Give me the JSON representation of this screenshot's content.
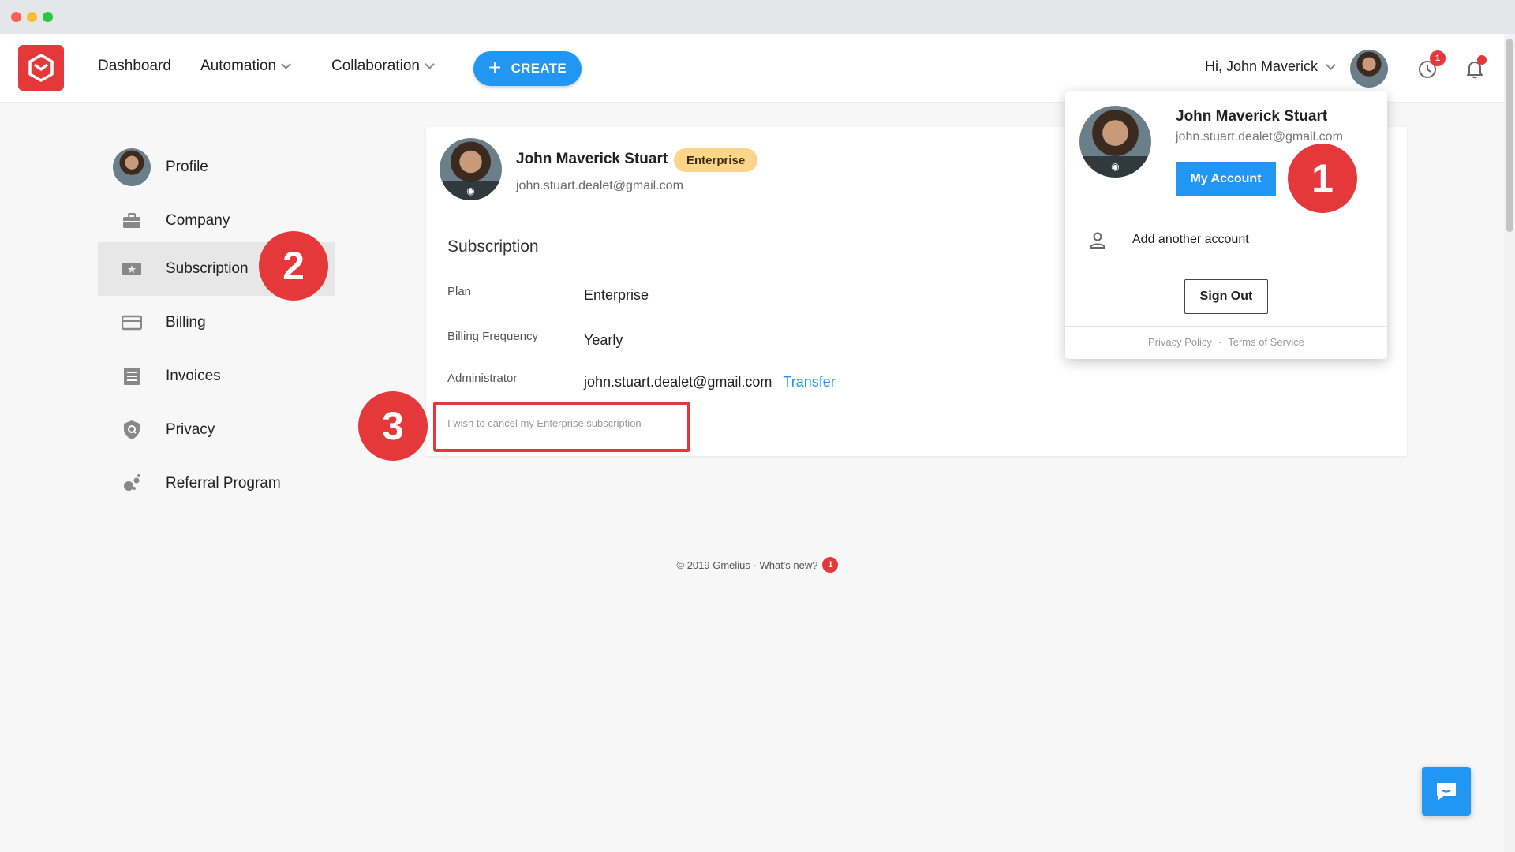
{
  "nav": {
    "items": [
      {
        "label": "Dashboard"
      },
      {
        "label": "Automation"
      },
      {
        "label": "Collaboration"
      }
    ],
    "create_label": "CREATE",
    "greeting": "Hi, John Maverick",
    "history_badge": "1"
  },
  "sidebar": {
    "items": [
      {
        "label": "Profile",
        "icon": "avatar"
      },
      {
        "label": "Company",
        "icon": "briefcase-icon"
      },
      {
        "label": "Subscription",
        "icon": "ticket-icon",
        "active": true
      },
      {
        "label": "Billing",
        "icon": "credit-card-icon"
      },
      {
        "label": "Invoices",
        "icon": "document-icon"
      },
      {
        "label": "Privacy",
        "icon": "shield-icon"
      },
      {
        "label": "Referral Program",
        "icon": "referral-icon"
      }
    ]
  },
  "profile": {
    "name": "John Maverick Stuart",
    "tier": "Enterprise",
    "email": "john.stuart.dealet@gmail.com"
  },
  "subscription": {
    "title": "Subscription",
    "rows": [
      {
        "label": "Plan",
        "value": "Enterprise"
      },
      {
        "label": "Billing Frequency",
        "value": "Yearly"
      },
      {
        "label": "Administrator",
        "value": "john.stuart.dealet@gmail.com"
      }
    ],
    "transfer_label": "Transfer",
    "cancel_text": "I wish to cancel my Enterprise subscription"
  },
  "footer": {
    "copyright": "© 2019 Gmelius · What's new?",
    "badge": "1"
  },
  "dropdown": {
    "name": "John Maverick Stuart",
    "email": "john.stuart.dealet@gmail.com",
    "my_account_label": "My Account",
    "add_account_label": "Add another account",
    "sign_out_label": "Sign Out",
    "privacy_label": "Privacy Policy",
    "separator": "·",
    "terms_label": "Terms of Service"
  },
  "steps": [
    "1",
    "2",
    "3"
  ],
  "colors": {
    "brand_red": "#e5383b",
    "accent_blue": "#2196f3",
    "tier_yellow": "#fcd58a"
  }
}
